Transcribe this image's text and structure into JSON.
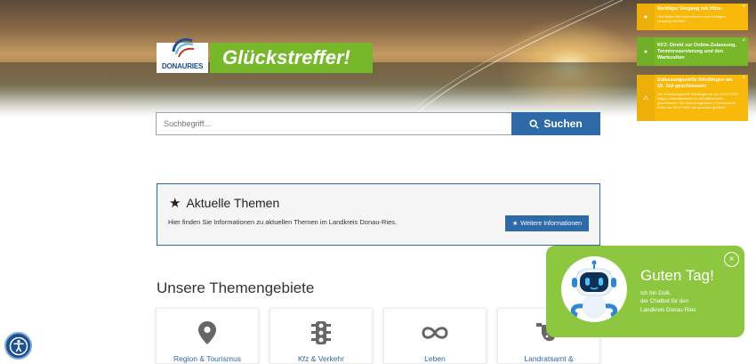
{
  "brand": {
    "logo_text": "DONAURIES",
    "claim": "Glückstreffer!"
  },
  "search": {
    "placeholder": "Suchbegriff...",
    "button_label": "Suchen"
  },
  "notices": [
    {
      "title": "Richtiger Umgang mit Hitze",
      "text": "Hier finden Sie Informationen zum richtigen Umgang mit Hitze",
      "color": "#f9b90a"
    },
    {
      "title": "KFZ: Direkt zur Online-Zulassung, Terminreservierung und den Wartezeiten",
      "text": "",
      "color": "#76b82a"
    },
    {
      "title": "Zulassungsstelle Nördlingen am 15. Juli geschlossen!",
      "text": "Die Zulassungsstelle Nördlingen ist am 15.07.2024 wegen Umbauarbeiten im Schalterbereich geschlossen. Die Zulassungsstelle in Donauwörth bleibt am 15.07.2024 wie gewohnt geöffnet.",
      "color": "#f9b90a"
    }
  ],
  "themen": {
    "title": "Aktuelle Themen",
    "text": "Hier finden Sie Informationen zu aktuellen Themen im Landkreis Donau-Ries.",
    "button_label": "Weitere Informationen"
  },
  "section_heading": "Unsere Themengebiete",
  "cards": [
    {
      "label": "Region & Tourismus",
      "icon": "map-pin-icon"
    },
    {
      "label": "Kfz & Verkehr",
      "icon": "traffic-light-icon"
    },
    {
      "label": "Leben",
      "icon": "infinity-icon"
    },
    {
      "label": "Landratsamt &",
      "icon": "handshake-icon"
    }
  ],
  "chatbot": {
    "title": "Guten Tag!",
    "line1": "Ich bin Dolli,",
    "line2": "der Chatbot für den",
    "line3": "Landkreis Donau-Ries"
  },
  "colors": {
    "primary": "#2d6aa7",
    "green": "#76b82a",
    "chat_green": "#8dc63f",
    "notice_yellow": "#f9b90a"
  }
}
